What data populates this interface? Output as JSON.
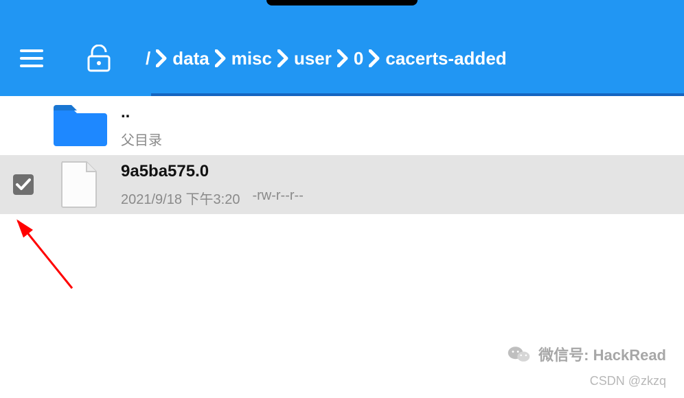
{
  "breadcrumb": {
    "root": "/",
    "items": [
      "data",
      "misc",
      "user",
      "0",
      "cacerts-added"
    ]
  },
  "rows": {
    "parent": {
      "name": "..",
      "sub": "父目录"
    },
    "file0": {
      "name": "9a5ba575.0",
      "date": "2021/9/18 下午3:20",
      "perms": "-rw-r--r--"
    }
  },
  "watermark": {
    "label": "微信号:",
    "value": "HackRead",
    "csdn": "CSDN @zkzq"
  },
  "colors": {
    "primary": "#2196f3",
    "underline": "#1565c0",
    "selected": "#e4e4e4"
  }
}
